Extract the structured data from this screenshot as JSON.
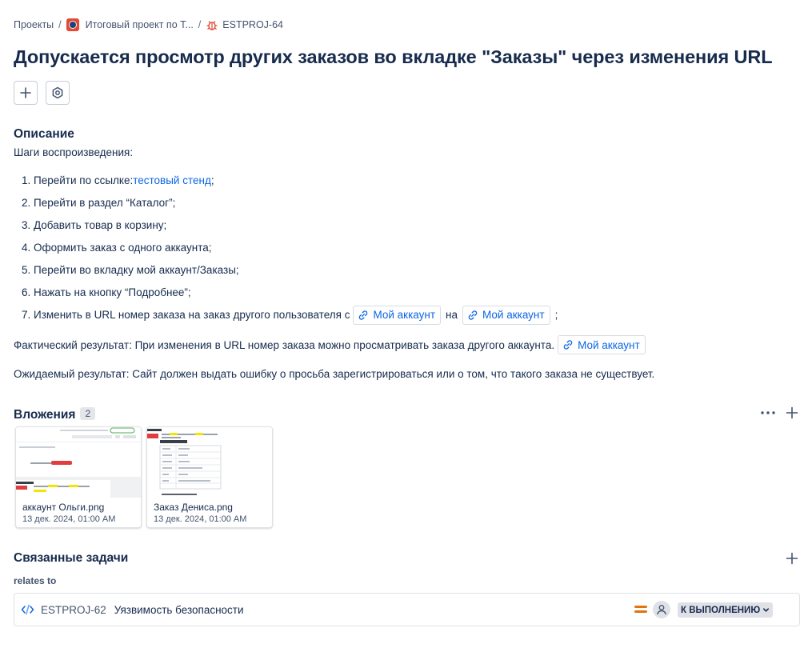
{
  "breadcrumb": {
    "projects": "Проекты",
    "project": "Итоговый проект по Т...",
    "issue_key": "ESTPROJ-64",
    "separator": "/"
  },
  "title": "Допускается просмотр других заказов во вкладке \"Заказы\" через изменения URL",
  "description": {
    "heading": "Описание",
    "steps_intro": "Шаги воспроизведения:",
    "steps": [
      "1. Перейти по ссылке: ",
      "2. Перейти в раздел “Каталог”;",
      "3. Добавить товар в корзину;",
      "4. Оформить заказ с одного аккаунта;",
      "5. Перейти во вкладку мой аккаунт/Заказы;",
      "6. Нажать на кнопку “Подробнее”;",
      "7. Изменить в URL номер заказа на заказ другого пользователя с"
    ],
    "step1_link": "тестовый стенд",
    "step1_suffix": ";",
    "step7_between": "на",
    "step7_end": ";",
    "chip_label": "Мой аккаунт",
    "actual": "Фактический результат: При изменения в URL номер заказа можно просматривать заказа другого аккаунта.",
    "expected": "Ожидаемый результат: Сайт должен выдать ошибку о просьба зарегистрироваться или о том, что такого заказа не существует."
  },
  "attachments": {
    "heading": "Вложения",
    "count": "2",
    "items": [
      {
        "name": "аккаунт Ольги.png",
        "date": "13 дек. 2024, 01:00 AM"
      },
      {
        "name": "Заказ Дениса.png",
        "date": "13 дек. 2024, 01:00 AM"
      }
    ]
  },
  "linked": {
    "heading": "Связанные задачи",
    "relation": "relates to",
    "issue": {
      "key": "ESTPROJ-62",
      "summary": "Уязвимость безопасности",
      "status": "К ВЫПОЛНЕНИЮ"
    }
  },
  "colors": {
    "link": "#0c66e4",
    "text": "#172b4d",
    "priority": "#e2740f",
    "bug": "#e34935"
  },
  "icons": [
    "project-avatar-icon",
    "bug-icon",
    "plus-icon",
    "settings-icon",
    "link-icon",
    "more-icon",
    "code-icon",
    "priority-medium-icon",
    "user-avatar-icon",
    "chevron-down-icon"
  ]
}
